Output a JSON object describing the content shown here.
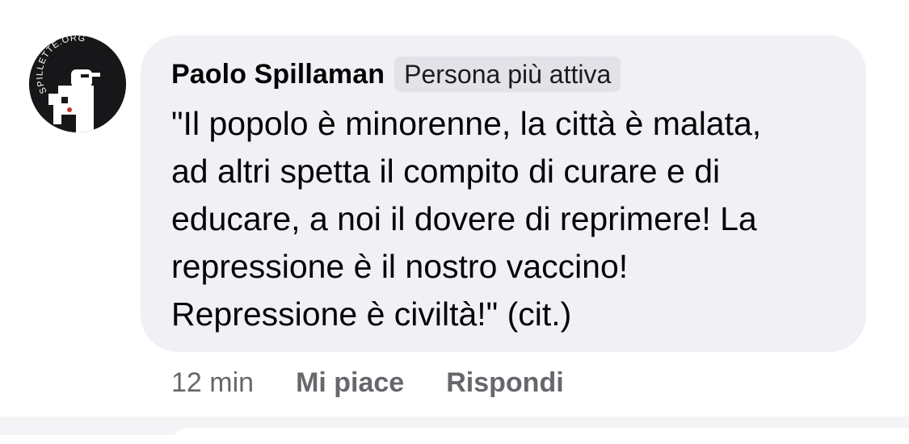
{
  "comment": {
    "avatar": {
      "logo_text": "SPILLETTE.ORG",
      "icon": "avatar-logo-icon"
    },
    "author": "Paolo Spillaman",
    "badge": "Persona più attiva",
    "text": "\"Il popolo è minorenne, la città è malata,\nad altri spetta il compito di curare e di\neducare, a noi il dovere di reprimere! La\nrepressione è il nostro vaccino!\nRepressione è civiltà!\" (cit.)",
    "actions": {
      "time": "12 min",
      "like": "Mi piace",
      "reply": "Rispondi"
    }
  },
  "colors": {
    "bubble_background": "#f0f0f5",
    "badge_background": "#e2e2e8",
    "secondary_text": "#65676b",
    "primary_text": "#050505",
    "avatar_background": "#17171a"
  }
}
